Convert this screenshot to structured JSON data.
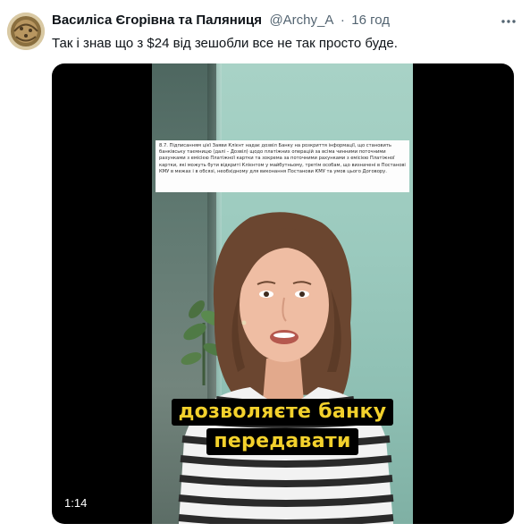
{
  "tweet": {
    "author_name": "Василіса Єгорівна та Паляниця",
    "handle": "@Archy_A",
    "separator": "·",
    "time": "16 год",
    "text": "Так і знав що з $24 від зешобли все не так просто буде.",
    "more_icon": "more-horizontal-icon"
  },
  "video": {
    "duration": "1:14",
    "document_excerpt": "8.7. Підписанням цієї Заяви Клієнт надає дозвіл Банку на розкриття інформації, що становить банківську таємницю (далі – Дозвіл) щодо платіжних операцій за всіма чинними поточними рахунками з емісією Платіжної картки та зокрема за поточними рахунками з емісією Платіжної картки, які можуть бути відкриті Клієнтом у майбутньому, третім особам, що визначені в Постанові КМУ в межах і в обсязі, необхідному для виконання Постанови КМУ та умов цього Договору.",
    "caption_line_1": "дозволяєте банку",
    "caption_line_2": "передавати"
  },
  "colors": {
    "caption_text": "#f3d12c",
    "caption_bg": "#000000",
    "handle_gray": "#536471"
  }
}
